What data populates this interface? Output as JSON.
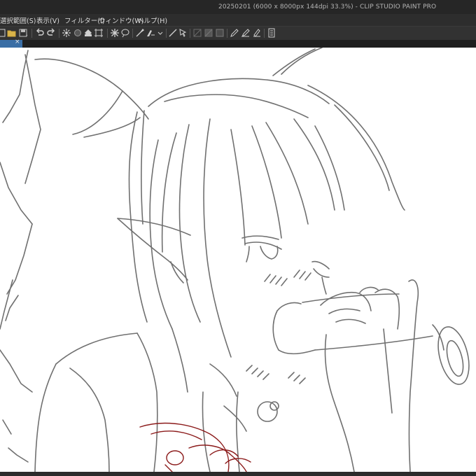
{
  "window": {
    "title": "20250201 (6000 x 8000px 144dpi 33.3%) - CLIP STUDIO PAINT PRO"
  },
  "menu": {
    "items": [
      {
        "label": "選択範囲(S)"
      },
      {
        "label": "表示(V)"
      },
      {
        "label": "フィルター(I)"
      },
      {
        "label": "ウィンドウ(W)"
      },
      {
        "label": "ヘルプ(H)"
      }
    ]
  },
  "toolbar": {
    "icons": [
      "new-file-icon",
      "open-folder-icon",
      "save-icon",
      "undo-icon",
      "redo-icon",
      "clear-icon",
      "fill-icon",
      "transform-icon",
      "select-icon",
      "lasso-icon",
      "eyedropper-icon",
      "brush-settings-icon",
      "ruler-icon",
      "pointer-icon",
      "pen-icon",
      "pencil-icon",
      "marker-icon",
      "panel-icon"
    ]
  },
  "tab": {
    "close_label": "×"
  },
  "canvas": {
    "line_color": "#707070",
    "sketch_color": "#8b1a1a",
    "background": "#ffffff"
  }
}
